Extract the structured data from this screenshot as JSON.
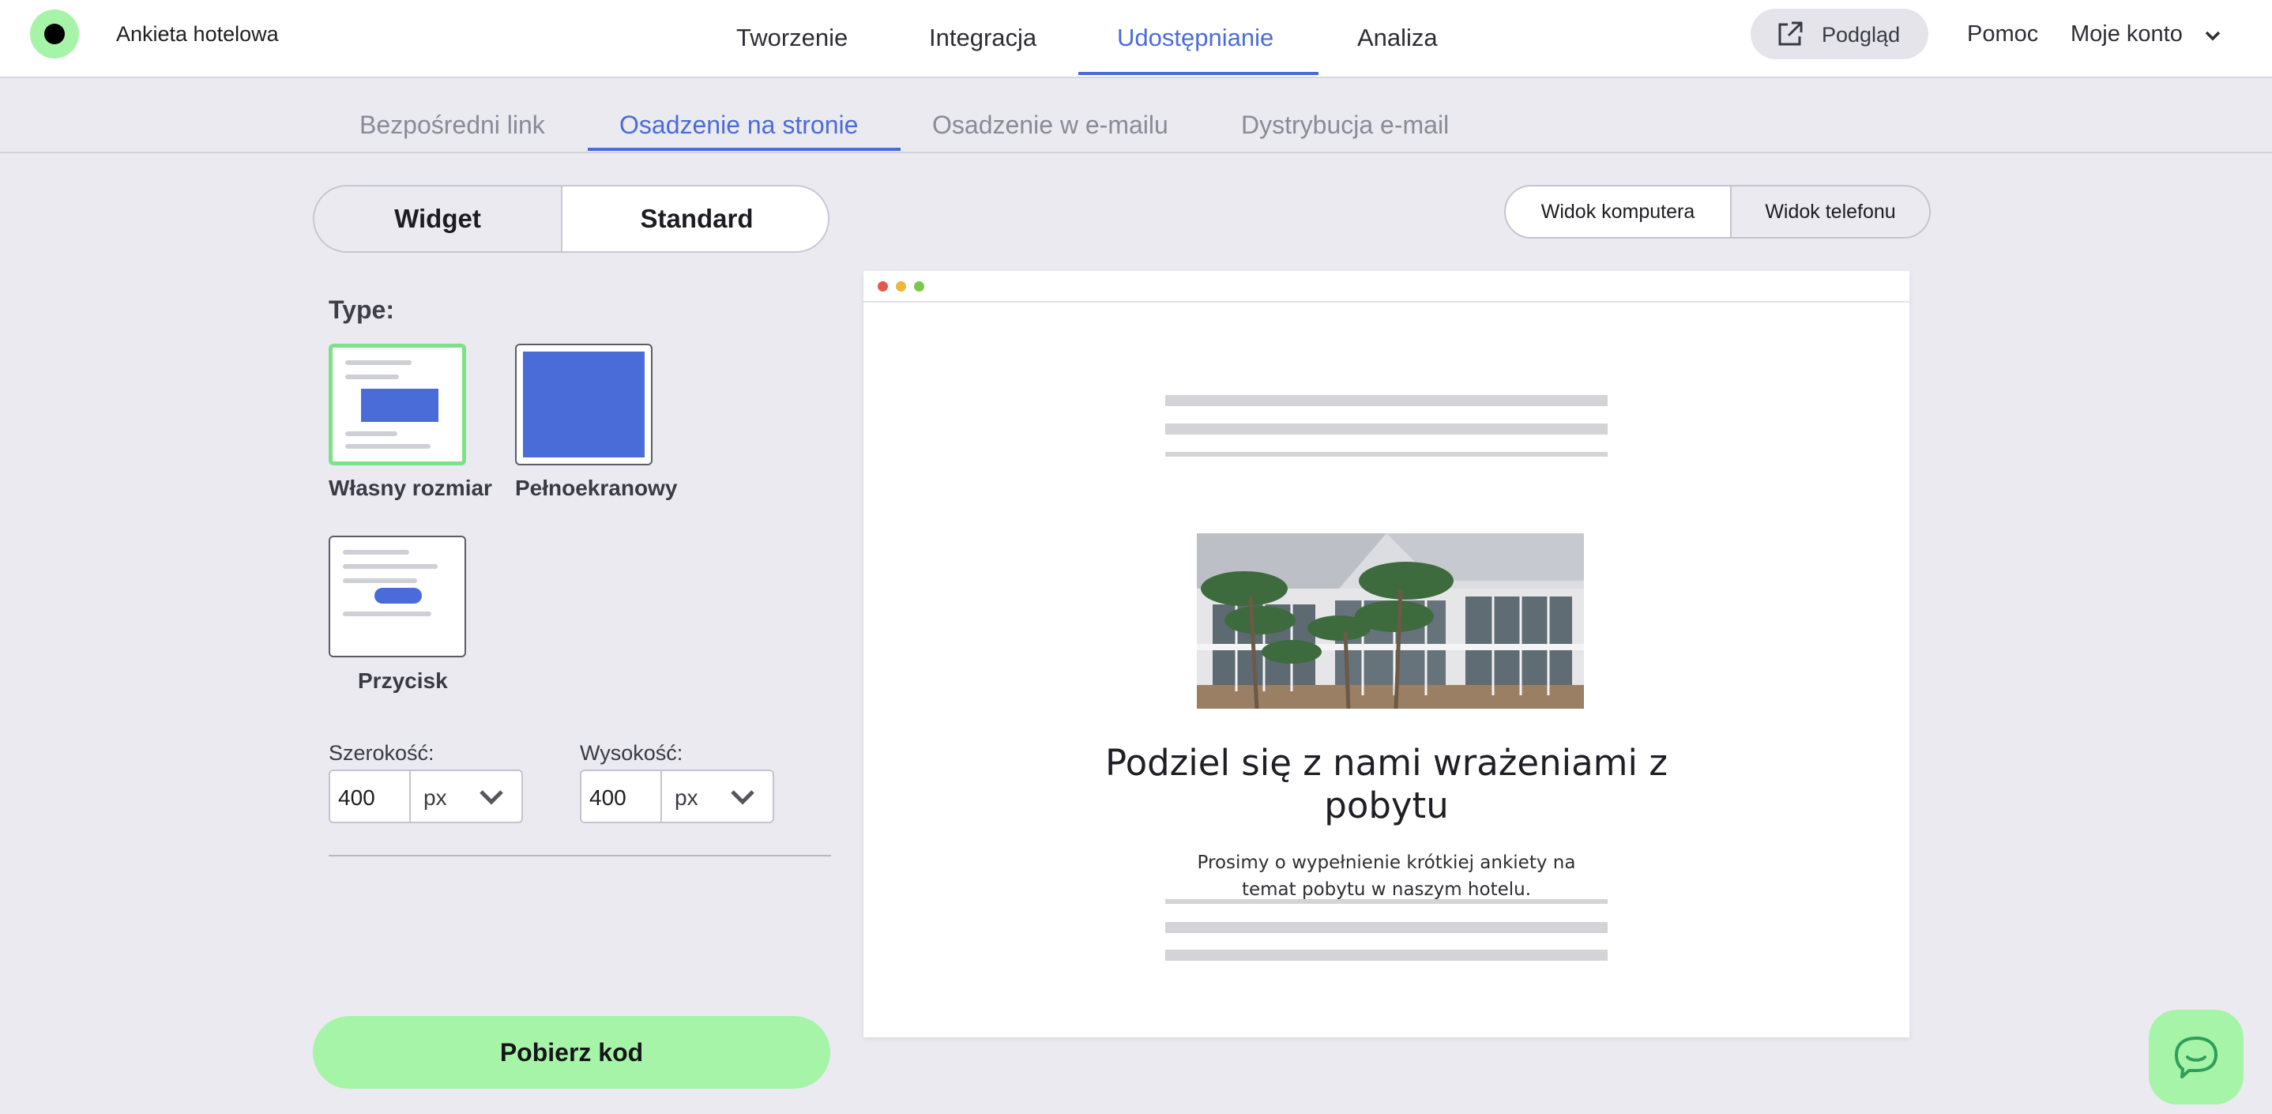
{
  "header": {
    "survey_title": "Ankieta hotelowa",
    "tabs": [
      "Tworzenie",
      "Integracja",
      "Udostępnianie",
      "Analiza"
    ],
    "active_tab": "Udostępnianie",
    "preview_label": "Podgląd",
    "help_label": "Pomoc",
    "account_label": "Moje konto"
  },
  "subtabs": {
    "items": [
      "Bezpośredni link",
      "Osadzenie na stronie",
      "Osadzenie w e-mailu",
      "Dystrybucja e-mail"
    ],
    "active": "Osadzenie na stronie"
  },
  "mode": {
    "widget_label": "Widget",
    "standard_label": "Standard",
    "selected": "Standard"
  },
  "view": {
    "desktop_label": "Widok komputera",
    "phone_label": "Widok telefonu",
    "selected": "Widok komputera"
  },
  "type_section": {
    "label": "Type:",
    "options": [
      "Własny rozmiar",
      "Pełnoekranowy",
      "Przycisk"
    ],
    "selected": "Własny rozmiar"
  },
  "size": {
    "width_label": "Szerokość:",
    "width_value": "400",
    "width_unit": "px",
    "height_label": "Wysokość:",
    "height_value": "400",
    "height_unit": "px"
  },
  "download_label": "Pobierz kod",
  "preview": {
    "title": "Podziel się z nami wrażeniami z pobytu",
    "description": "Prosimy o wypełnienie krótkiej ankiety na temat pobytu w naszym hotelu."
  },
  "colors": {
    "accent_blue": "#4a6cd8",
    "accent_green": "#a6f4a7",
    "background": "#eaeaf0"
  },
  "icons": {
    "preview": "external-link-icon",
    "account": "chevron-down-icon",
    "chat": "chat-bubble-icon"
  }
}
